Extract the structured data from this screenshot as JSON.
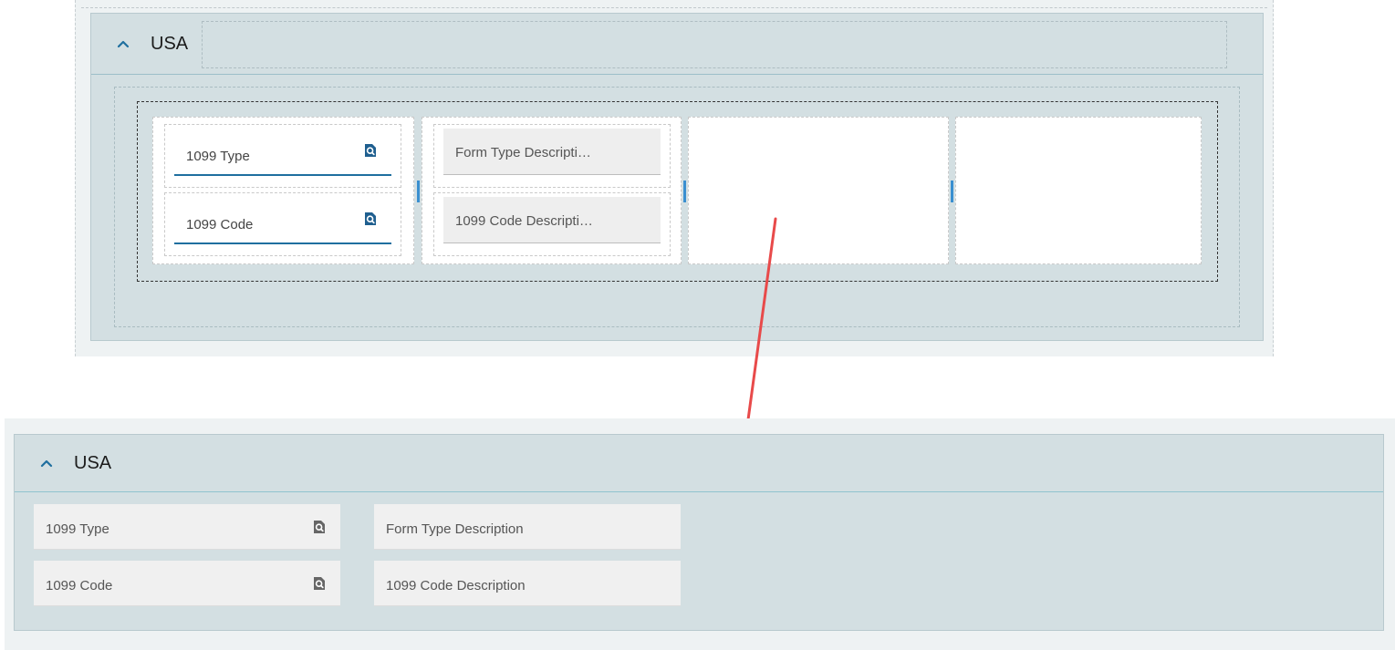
{
  "designer": {
    "section": {
      "title": "USA",
      "fields": {
        "type_label": "1099 Type",
        "code_label": "1099 Code",
        "form_desc_label": "Form Type Descripti…",
        "code_desc_label": "1099 Code Descripti…"
      }
    }
  },
  "preview": {
    "section": {
      "title": "USA",
      "fields": {
        "type_label": "1099 Type",
        "code_label": "1099 Code",
        "form_desc_label": "Form Type Description",
        "code_desc_label": "1099 Code Description"
      }
    }
  },
  "icons": {
    "collapse": "chevron-up-icon",
    "lookup": "lookup-search-icon",
    "annotation": "red-arrow"
  },
  "colors": {
    "accent": "#1f6f9f",
    "panel": "#d3dfe2",
    "arrow": "#e84a4a",
    "splitter": "#3a8fd0"
  }
}
